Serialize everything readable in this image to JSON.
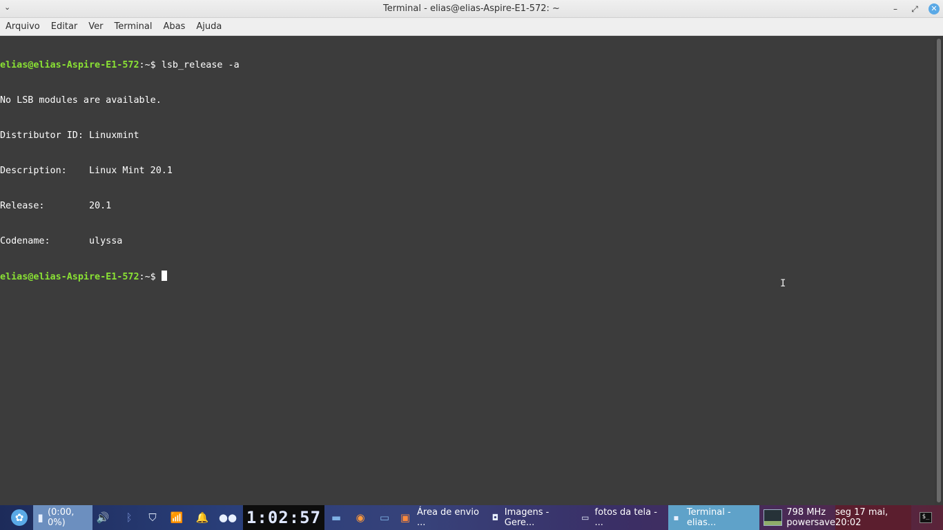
{
  "window": {
    "title": "Terminal - elias@elias-Aspire-E1-572: ~",
    "minimize": "–",
    "maximize": "⤢",
    "close": "✕"
  },
  "menu": [
    "Arquivo",
    "Editar",
    "Ver",
    "Terminal",
    "Abas",
    "Ajuda"
  ],
  "terminal": {
    "prompt": "elias@elias-Aspire-E1-572",
    "path": ":~$",
    "command": " lsb_release -a",
    "output": [
      "No LSB modules are available.",
      "Distributor ID: Linuxmint",
      "Description:    Linux Mint 20.1",
      "Release:        20.1",
      "Codename:       ulyssa"
    ],
    "prompt2": "elias@elias-Aspire-E1-572",
    "path2": ":~$",
    "after2": " "
  },
  "taskbar": {
    "battery_text": "(0:00, 0%)",
    "clock": "1:02:57",
    "windows": [
      {
        "label": "Área de envio ...",
        "icon": "camera-icon"
      },
      {
        "label": "Imagens - Gere...",
        "icon": "camera-icon"
      },
      {
        "label": "fotos da tela - ...",
        "icon": "folder-icon"
      },
      {
        "label": "Terminal - elias...",
        "icon": "terminal-icon"
      }
    ],
    "cpu_freq": "798 MHz",
    "cpu_governor": "powersave",
    "date": "seg 17 mai, 20:02",
    "term_glyph": "$_"
  }
}
